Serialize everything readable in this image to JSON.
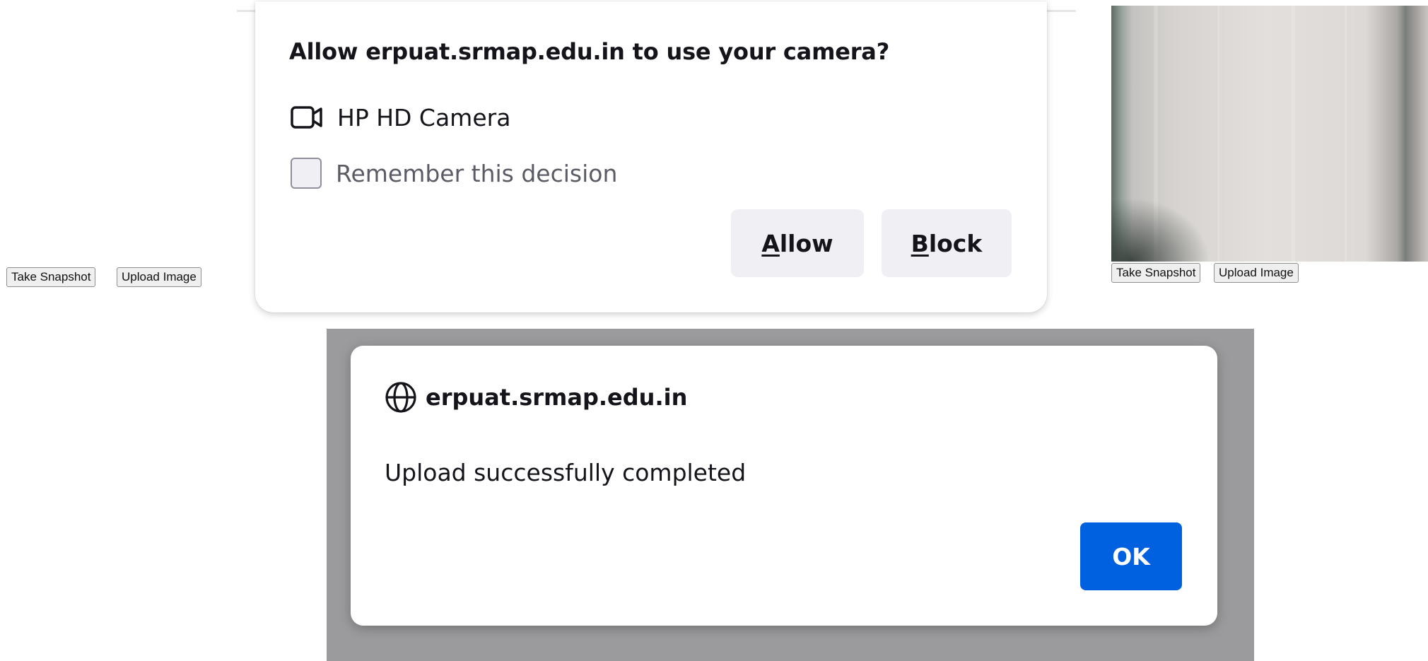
{
  "left_controls": {
    "take_snapshot": "Take Snapshot",
    "upload_image": "Upload Image"
  },
  "permission_prompt": {
    "title": "Allow erpuat.srmap.edu.in to use your camera?",
    "device_name": "HP HD Camera",
    "device_icon": "camera-icon",
    "remember_label": "Remember this decision",
    "remember_checked": false,
    "allow_prefix": "A",
    "allow_rest": "llow",
    "block_prefix": "B",
    "block_rest": "lock"
  },
  "camera_controls": {
    "take_snapshot": "Take Snapshot",
    "upload_image": "Upload Image"
  },
  "alert": {
    "origin": "erpuat.srmap.edu.in",
    "origin_icon": "globe-icon",
    "message": "Upload successfully completed",
    "ok_label": "OK"
  },
  "colors": {
    "primary_button": "#0061e0",
    "secondary_button": "#f0f0f4",
    "overlay": "#9b9b9d"
  }
}
